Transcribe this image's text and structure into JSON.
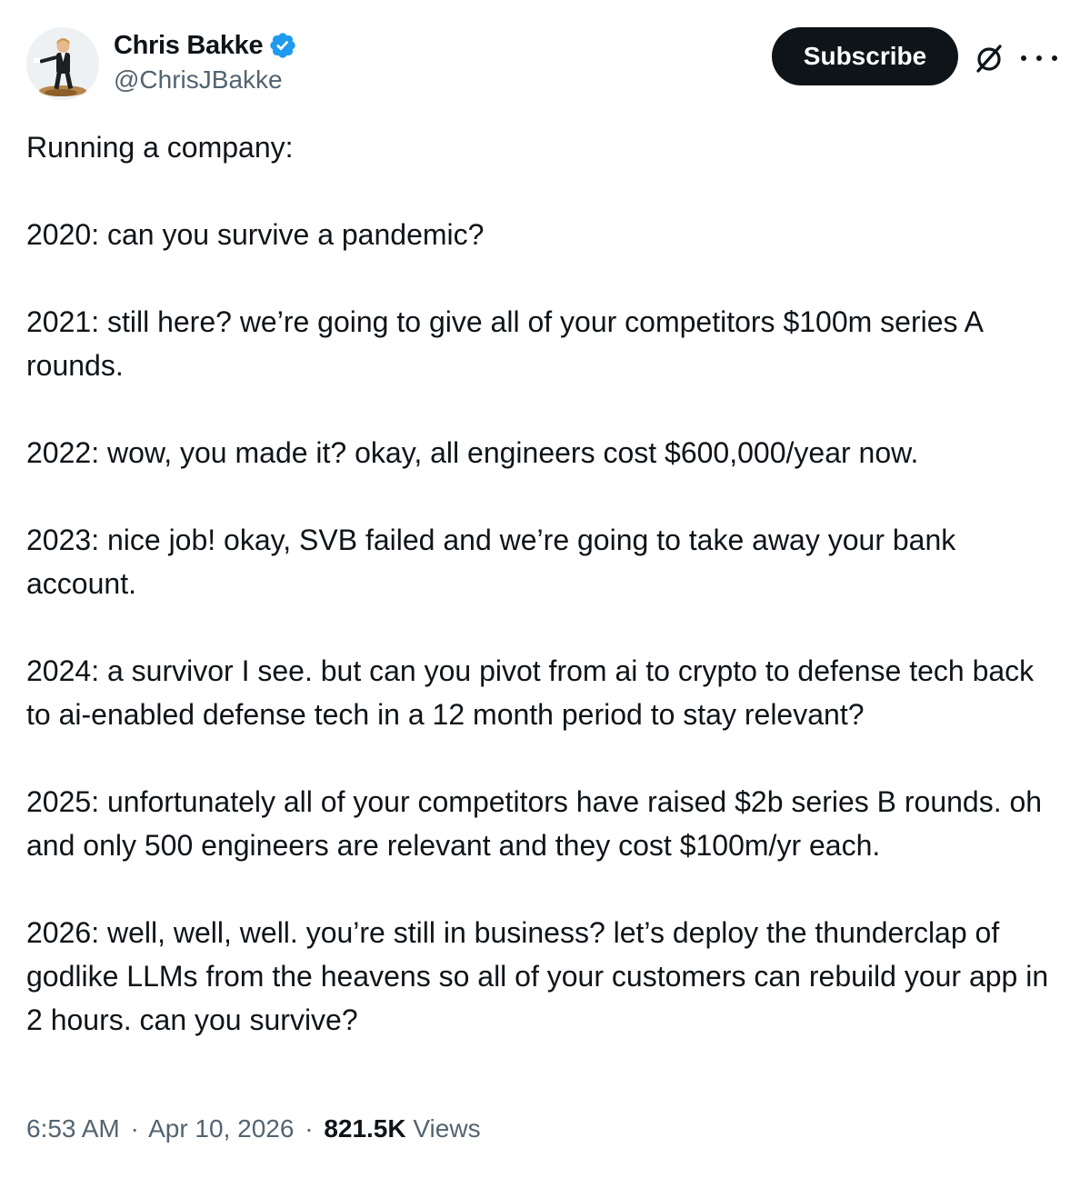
{
  "author": {
    "display_name": "Chris Bakke",
    "handle": "@ChrisJBakke",
    "verified": true,
    "avatar_icon": "cartoon-man-avatar"
  },
  "actions": {
    "subscribe_label": "Subscribe",
    "grok_icon": "grok-icon",
    "more_icon": "more-options-icon"
  },
  "tweet": {
    "paragraphs": [
      "Running a company:",
      "2020: can you survive a pandemic?",
      "2021: still here? we’re going to give all of your competitors $100m series A rounds.",
      "2022: wow, you made it? okay, all engineers cost $600,000/year now.",
      "2023: nice job! okay, SVB failed and we’re going to take away your bank account.",
      "2024: a survivor I see. but can you pivot from ai to crypto to defense tech back to ai-enabled defense tech in a 12 month period to stay relevant?",
      "2025: unfortunately all of your competitors have raised $2b series B rounds. oh and only 500 engineers are relevant and they cost $100m/yr each.",
      "2026: well, well, well. you’re still in business? let’s deploy the thunderclap of godlike LLMs from the heavens so all of your customers can rebuild your app in 2 hours. can you survive?"
    ]
  },
  "meta": {
    "time": "6:53 AM",
    "separator": "·",
    "date": "Apr 10, 2026",
    "views_count": "821.5K",
    "views_label": "Views"
  },
  "colors": {
    "text_primary": "#0f1419",
    "text_secondary": "#536471",
    "verified_blue": "#1d9bf0",
    "button_bg": "#0f1419",
    "button_text": "#ffffff"
  }
}
